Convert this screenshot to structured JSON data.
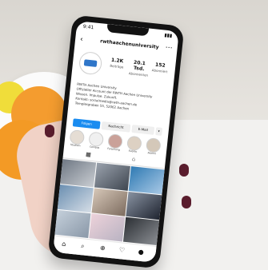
{
  "photo": {
    "status_time": "9:41",
    "status_signal": "▮▮▮",
    "profile_handle": "rwthaachenuniversity",
    "stats": [
      {
        "value": "1.2K",
        "label": "Beiträge"
      },
      {
        "value": "20.1 Tsd.",
        "label": "Abonnenten"
      },
      {
        "value": "152",
        "label": "Abonniert"
      }
    ],
    "bio_lines": [
      "RWTH Aachen University",
      "Offizieller Account der RWTH Aachen University",
      "Wissen. Impulse. Zukunft.",
      "Kontakt: socialmedia@rwth-aachen.de",
      "Templergraben 55, 52062 Aachen"
    ],
    "buttons": [
      "Folgen",
      "Nachricht",
      "E-Mail",
      "▾"
    ],
    "highlights": [
      "Studium",
      "Campus",
      "Forschung",
      "Events",
      "Alumni"
    ],
    "tabs_icons": [
      "grid-icon",
      "tagged-icon"
    ],
    "nav_icons": [
      "home-icon",
      "search-icon",
      "add-icon",
      "heart-icon",
      "profile-icon"
    ]
  }
}
